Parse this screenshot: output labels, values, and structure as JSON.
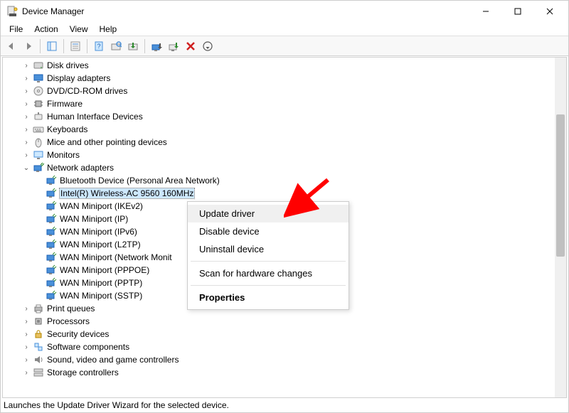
{
  "title": "Device Manager",
  "menus": {
    "file": "File",
    "action": "Action",
    "view": "View",
    "help": "Help"
  },
  "tree": {
    "items": [
      {
        "label": "Disk drives",
        "depth": 1,
        "expanded": false,
        "icon": "disk"
      },
      {
        "label": "Display adapters",
        "depth": 1,
        "expanded": false,
        "icon": "display"
      },
      {
        "label": "DVD/CD-ROM drives",
        "depth": 1,
        "expanded": false,
        "icon": "disc"
      },
      {
        "label": "Firmware",
        "depth": 1,
        "expanded": false,
        "icon": "chip"
      },
      {
        "label": "Human Interface Devices",
        "depth": 1,
        "expanded": false,
        "icon": "hid"
      },
      {
        "label": "Keyboards",
        "depth": 1,
        "expanded": false,
        "icon": "keyboard"
      },
      {
        "label": "Mice and other pointing devices",
        "depth": 1,
        "expanded": false,
        "icon": "mouse"
      },
      {
        "label": "Monitors",
        "depth": 1,
        "expanded": false,
        "icon": "monitor"
      },
      {
        "label": "Network adapters",
        "depth": 1,
        "expanded": true,
        "icon": "network"
      },
      {
        "label": "Bluetooth Device (Personal Area Network)",
        "depth": 2,
        "expanded": null,
        "icon": "net"
      },
      {
        "label": "Intel(R) Wireless-AC 9560 160MHz",
        "depth": 2,
        "expanded": null,
        "icon": "net",
        "selected": true
      },
      {
        "label": "WAN Miniport (IKEv2)",
        "depth": 2,
        "expanded": null,
        "icon": "net"
      },
      {
        "label": "WAN Miniport (IP)",
        "depth": 2,
        "expanded": null,
        "icon": "net"
      },
      {
        "label": "WAN Miniport (IPv6)",
        "depth": 2,
        "expanded": null,
        "icon": "net"
      },
      {
        "label": "WAN Miniport (L2TP)",
        "depth": 2,
        "expanded": null,
        "icon": "net"
      },
      {
        "label": "WAN Miniport (Network Monit",
        "depth": 2,
        "expanded": null,
        "icon": "net"
      },
      {
        "label": "WAN Miniport (PPPOE)",
        "depth": 2,
        "expanded": null,
        "icon": "net"
      },
      {
        "label": "WAN Miniport (PPTP)",
        "depth": 2,
        "expanded": null,
        "icon": "net"
      },
      {
        "label": "WAN Miniport (SSTP)",
        "depth": 2,
        "expanded": null,
        "icon": "net"
      },
      {
        "label": "Print queues",
        "depth": 1,
        "expanded": false,
        "icon": "printer"
      },
      {
        "label": "Processors",
        "depth": 1,
        "expanded": false,
        "icon": "cpu"
      },
      {
        "label": "Security devices",
        "depth": 1,
        "expanded": false,
        "icon": "lock"
      },
      {
        "label": "Software components",
        "depth": 1,
        "expanded": false,
        "icon": "component"
      },
      {
        "label": "Sound, video and game controllers",
        "depth": 1,
        "expanded": false,
        "icon": "sound"
      },
      {
        "label": "Storage controllers",
        "depth": 1,
        "expanded": false,
        "icon": "storage"
      }
    ]
  },
  "context_menu": {
    "items": [
      {
        "label": "Update driver",
        "highlight": true
      },
      {
        "label": "Disable device"
      },
      {
        "label": "Uninstall device"
      },
      {
        "sep": true
      },
      {
        "label": "Scan for hardware changes"
      },
      {
        "sep": true
      },
      {
        "label": "Properties",
        "bold": true
      }
    ]
  },
  "statusbar": "Launches the Update Driver Wizard for the selected device."
}
